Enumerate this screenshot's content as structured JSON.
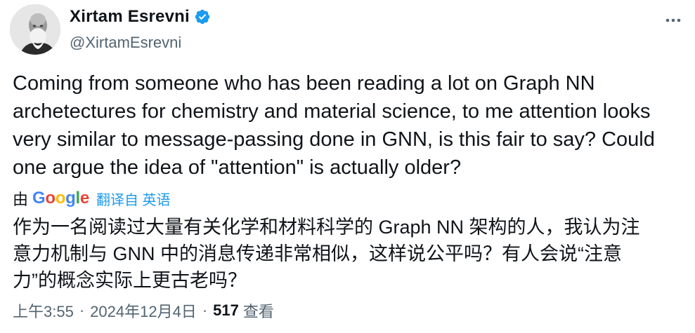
{
  "author": {
    "display_name": "Xirtam Esrevni",
    "handle": "@XirtamEsrevni",
    "verified": true
  },
  "tweet": {
    "text": "Coming from someone who has been reading a lot on Graph NN\narchetectures for chemistry and material science, to me attention looks\nvery similar to message-passing done in GNN, is this fair to say? Could\none argue the idea of \"attention\" is actually older?"
  },
  "translation": {
    "by_label": "由",
    "provider_logo": [
      "G",
      "o",
      "o",
      "g",
      "l",
      "e"
    ],
    "link_text": "翻译自 英语",
    "text": "作为一名阅读过大量有关化学和材料科学的 Graph NN 架构的人，我认为注\n意力机制与 GNN 中的消息传递非常相似，这样说公平吗？有人会说“注意\n力”的概念实际上更古老吗？"
  },
  "meta": {
    "time": "上午3:55",
    "separator": "·",
    "date": "2024年12月4日",
    "views_count": "517",
    "views_label": "查看"
  },
  "colors": {
    "text": "#0f1419",
    "secondary": "#536471",
    "link": "#1d9bf0",
    "verified": "#1d9bf0"
  },
  "icons": {
    "verified": "verified-badge-icon",
    "more": "more-horizontal-icon"
  }
}
